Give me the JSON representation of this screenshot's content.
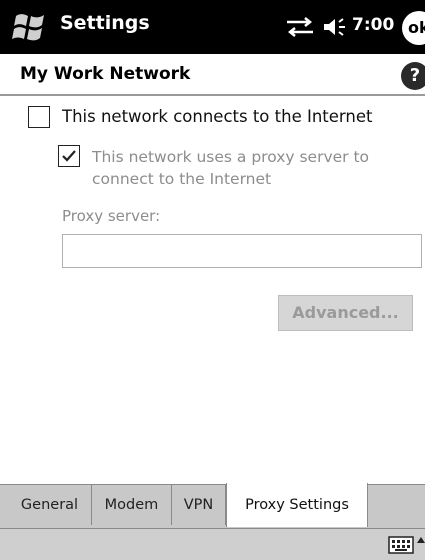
{
  "titlebar": {
    "title": "Settings",
    "clock": "7:00",
    "ok_label": "ok",
    "icons": [
      "windows-flag-icon",
      "connectivity-icon",
      "volume-icon"
    ]
  },
  "header": {
    "title": "My Work Network",
    "help_icon": "?"
  },
  "form": {
    "internet_checkbox": {
      "label": "This network connects to the Internet",
      "checked": false
    },
    "proxy_checkbox": {
      "label": "This network uses a proxy server to connect to the Internet",
      "checked": true
    },
    "proxy_server_label": "Proxy server:",
    "proxy_server_value": "",
    "advanced_label": "Advanced..."
  },
  "tabs": [
    {
      "label": "General",
      "active": false
    },
    {
      "label": "Modem",
      "active": false
    },
    {
      "label": "VPN",
      "active": false
    },
    {
      "label": "Proxy Settings",
      "active": true
    }
  ],
  "menubar": {
    "icons": [
      "keyboard-icon",
      "up-arrow-icon"
    ]
  },
  "colors": {
    "titlebar_bg": "#000000",
    "disabled_text": "#8d8d8d",
    "tab_bg": "#c8c8c8"
  }
}
